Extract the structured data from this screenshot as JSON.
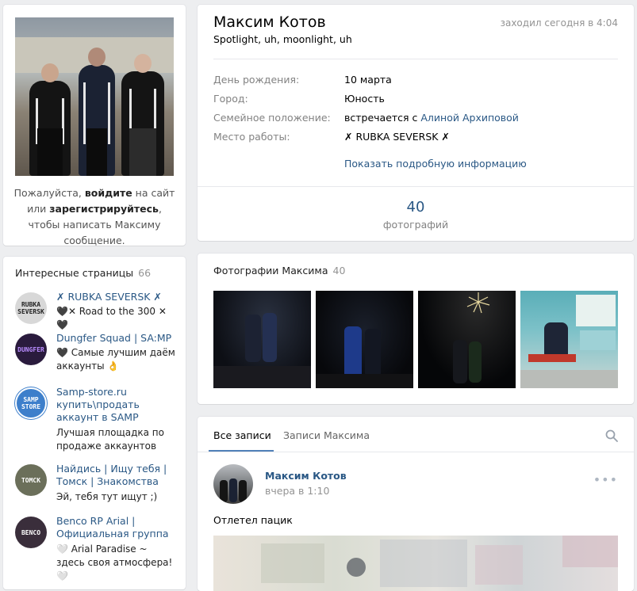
{
  "sidebar": {
    "login_prefix": "Пожалуйста, ",
    "login_link": "войдите",
    "login_mid": " на сайт или ",
    "register_link": "зарегистрируйтесь",
    "login_suffix": ", чтобы написать Максиму сообщение.",
    "pages_title": "Интересные страницы",
    "pages_count": "66",
    "pages": [
      {
        "title": "✗ RUBKA SEVERSK ✗",
        "desc": "🖤✕ Road to the 300 ✕🖤",
        "ava_text": "RUBKA SEVERSK",
        "ava_color": "#d8d8d8"
      },
      {
        "title": "Dungfer Squad | SA:MP",
        "desc": "🖤 Самые лучшим даём аккаунты 👌",
        "ava_text": "DUNGFER",
        "ava_color": "#2a1b3d"
      },
      {
        "title": "Samp-store.ru купить\\продать аккаунт в SAMP",
        "desc": "Лучшая площадка по продаже аккаунтов",
        "ava_text": "SAMP STORE",
        "ava_color": "#3d7fcb"
      },
      {
        "title": "Найдись | Ищу тебя | Томск | Знакомства",
        "desc": "Эй, тебя тут ищут ;)",
        "ava_text": "ТОМСК",
        "ava_color": "#6b6f5a"
      },
      {
        "title": "Benco RP Arial | Официальная группа",
        "desc": "🤍 Arial Paradise ~ здесь своя атмосфера! 🤍",
        "ava_text": "BENCO",
        "ava_color": "#3a2e3b"
      }
    ]
  },
  "profile": {
    "name": "Максим Котов",
    "status": "Spotlight, uh, moonlight, uh",
    "online": "заходил сегодня в 4:04",
    "info": [
      {
        "label": "День рождения:",
        "value": "10 марта",
        "is_link": true
      },
      {
        "label": "Город:",
        "value": "Юность",
        "is_link": true
      },
      {
        "label": "Семейное положение:",
        "value_prefix": "встречается с ",
        "value": "Алиной Архиповой",
        "is_link": true
      },
      {
        "label": "Место работы:",
        "value": "✗ RUBKA SEVERSK ✗",
        "is_link": true
      }
    ],
    "more_info": "Показать подробную информацию",
    "photo_count": "40",
    "photo_count_label": "фотографий"
  },
  "photos": {
    "title": "Фотографии Максима",
    "count": "40"
  },
  "wall": {
    "tab_all": "Все записи",
    "tab_own": "Записи Максима",
    "post": {
      "author": "Максим Котов",
      "time": "вчера в 1:10",
      "text": "Отлетел пацик",
      "menu": "•••"
    }
  },
  "colors": {
    "link": "#2a5885",
    "accent": "#5181b8",
    "muted": "#828282",
    "background": "#edeef0"
  }
}
